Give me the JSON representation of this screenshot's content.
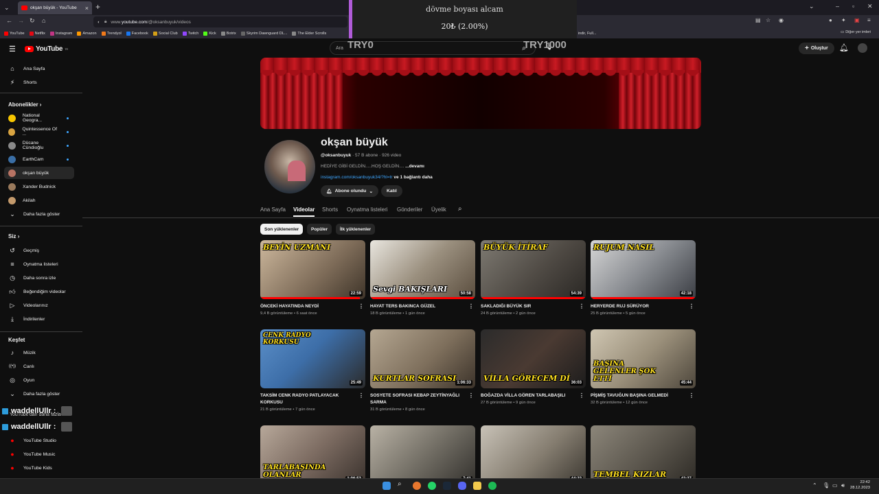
{
  "browser": {
    "tab_title": "okşan büyük - YouTube",
    "url_prefix": "www.",
    "url_domain": "youtube.com",
    "url_path": "/@oksanbuyuk/videos",
    "bookmarks": [
      "YouTube",
      "Netflix",
      "Instagram",
      "Amazon",
      "Trendyol",
      "Facebook",
      "Social Club",
      "Twitch",
      "Kick",
      "Botrix",
      "Skyrim Dawnguard DL...",
      "The Elder Scrolls",
      "nasty - Ek...",
      "borc_takip_afet_hasan...",
      "sims 4",
      "Torrent Oyun indir, Full..."
    ],
    "other_bookmarks": "Diğer yer imleri"
  },
  "overlay": {
    "donation_message": "dövme boyası alcam",
    "donation_progress": "20₺ (2.00%)",
    "progress_fraction": 0.02,
    "goal_min": "TRY0",
    "goal_max": "TRY1000",
    "accent": "#b05bd8"
  },
  "header": {
    "logo_text": "YouTube",
    "logo_region": "TR",
    "search_placeholder": "Ara",
    "create_label": "Oluştur"
  },
  "sidebar": {
    "top": [
      {
        "label": "Ana Sayfa",
        "icon": "home-icon"
      },
      {
        "label": "Shorts",
        "icon": "shorts-icon"
      }
    ],
    "subs_heading": "Abonelikler",
    "subscriptions": [
      {
        "label": "National Geogra...",
        "live": true
      },
      {
        "label": "Quintessence Of ...",
        "live": true
      },
      {
        "label": "Dücane Cündioğlu",
        "live": true
      },
      {
        "label": "EarthCam",
        "live": true
      },
      {
        "label": "okşan büyük",
        "live": false,
        "active": true
      },
      {
        "label": "Xander Budnick",
        "live": false
      },
      {
        "label": "Akilah",
        "live": false
      }
    ],
    "more_subs": "Daha fazla göster",
    "you_heading": "Siz",
    "you_items": [
      "Geçmiş",
      "Oynatma listeleri",
      "Daha sonra izle",
      "Beğendiğim videolar",
      "Videolarınız",
      "İndirilenler"
    ],
    "explore_heading": "Keşfet",
    "explore_items": [
      "Müzik",
      "Canlı",
      "Oyun"
    ],
    "more_explore": "Daha fazla göster",
    "yt_more_partial": "YouTube'dan daha fazla",
    "twitch_user": "waddellUllr :",
    "yt_apps": [
      "YouTube Studio",
      "YouTube Music",
      "YouTube Kids"
    ]
  },
  "channel": {
    "name": "okşan büyük",
    "handle": "@oksanbuyuk",
    "subscribers": "57 B abone",
    "video_count": "926 video",
    "description": "HEDİYE GİBİ GELDİN.....HOŞ GELDİN.... ",
    "more": "...devamı",
    "link": "instagram.com/oksanbuyuk34/?hl=tr",
    "link_more": "ve 1 bağlantı daha",
    "subscribed_label": "Abone olundu",
    "join_label": "Katıl",
    "tabs": [
      "Ana Sayfa",
      "Videolar",
      "Shorts",
      "Oynatma listeleri",
      "Gönderiler",
      "Üyelik"
    ],
    "chips": [
      "Son yüklenenler",
      "Popüler",
      "İlk yüklenenler"
    ]
  },
  "videos": [
    {
      "title": "ÖNCEKİ HAYATINDA NEYDİ",
      "views": "9,4 B görüntüleme",
      "age": "6 saat önce",
      "duration": "22:59",
      "overlay": "BEYİN UZMANI",
      "progress": 0.95
    },
    {
      "title": "HAYAT TERS BAKINCA GÜZEL",
      "views": "18 B görüntüleme",
      "age": "1 gün önce",
      "duration": "50:58",
      "overlay": "Sevgi BAKIŞLARI",
      "progress": 1.0
    },
    {
      "title": "SAKLADIĞI BÜYÜK SIR",
      "views": "24 B görüntüleme",
      "age": "2 gün önce",
      "duration": "54:39",
      "overlay": "BÜYÜK İTİRAF",
      "progress": 1.0
    },
    {
      "title": "HERYERDE RUJ SÜRÜYOR",
      "views": "25 B görüntüleme",
      "age": "5 gün önce",
      "duration": "42:18",
      "overlay": "RUJUM NASIL",
      "progress": 1.0
    },
    {
      "title": "TAKSİM CENK RADYO PATLAYACAK KORKUSU",
      "views": "21 B görüntüleme",
      "age": "7 gün önce",
      "duration": "25:49",
      "overlay": "CENK RADYO KORKUSU",
      "progress": 0
    },
    {
      "title": "SOSYETE SOFRASI KEBAP ZEYTİNYAĞLI SARMA",
      "views": "31 B görüntüleme",
      "age": "8 gün önce",
      "duration": "1:06:33",
      "overlay": "KURTLAR SOFRASI",
      "progress": 0
    },
    {
      "title": "BOĞAZDA VİLLA GÖREN TARLABAŞILI",
      "views": "27 B görüntüleme",
      "age": "9 gün önce",
      "duration": "36:03",
      "overlay": "VİLLA GÖRECEM Dİ",
      "progress": 0
    },
    {
      "title": "PİŞMİŞ TAVUĞUN BAŞINA GELMEDİ",
      "views": "32 B görüntüleme",
      "age": "12 gün önce",
      "duration": "45:44",
      "overlay": "BAŞINA GELENLER ŞOK ETTİ",
      "progress": 0
    },
    {
      "title": "",
      "views": "",
      "age": "",
      "duration": "1:06:53",
      "overlay": "TARLABAŞINDA OLANLAR",
      "progress": 0
    },
    {
      "title": "",
      "views": "",
      "age": "",
      "duration": "7:41",
      "overlay": "",
      "progress": 0
    },
    {
      "title": "",
      "views": "",
      "age": "",
      "duration": "44:22",
      "overlay": "",
      "progress": 0
    },
    {
      "title": "",
      "views": "",
      "age": "",
      "duration": "42:37",
      "overlay": "TEMBEL KIZLAR",
      "progress": 0
    }
  ],
  "taskbar": {
    "time": "22:42",
    "date": "28.12.2023"
  }
}
